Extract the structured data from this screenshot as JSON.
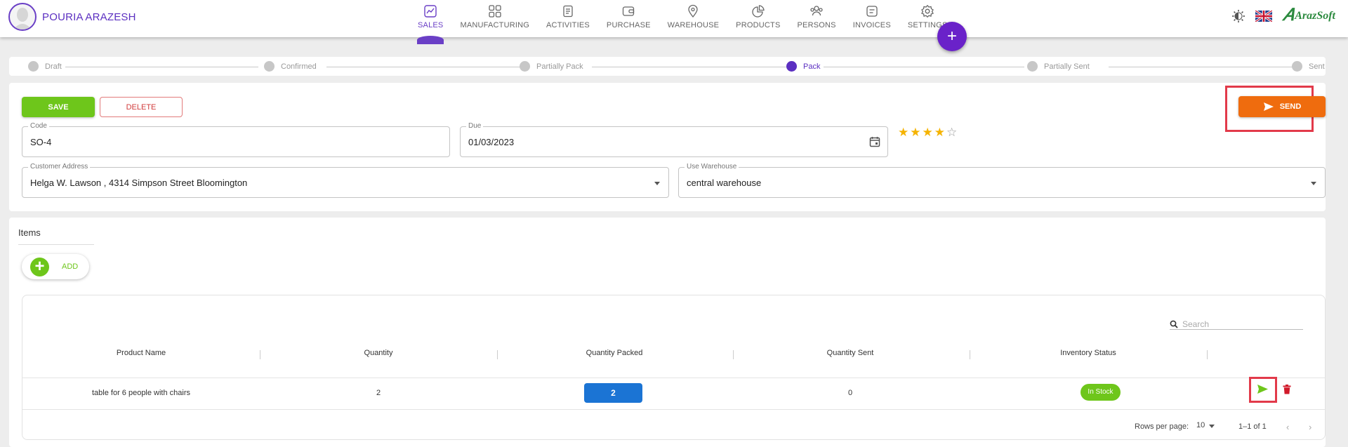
{
  "user": {
    "name": "POURIA ARAZESH"
  },
  "nav": [
    {
      "label": "SALES",
      "icon": "sales-icon",
      "active": true
    },
    {
      "label": "MANUFACTURING",
      "icon": "manufacturing-icon"
    },
    {
      "label": "ACTIVITIES",
      "icon": "activities-icon"
    },
    {
      "label": "PURCHASE",
      "icon": "purchase-icon"
    },
    {
      "label": "WAREHOUSE",
      "icon": "warehouse-icon"
    },
    {
      "label": "PRODUCTS",
      "icon": "products-icon"
    },
    {
      "label": "PERSONS",
      "icon": "persons-icon"
    },
    {
      "label": "INVOICES",
      "icon": "invoices-icon"
    },
    {
      "label": "SETTINGS",
      "icon": "settings-icon"
    }
  ],
  "fab": {
    "label": "+"
  },
  "brand": {
    "logo_text": "ArazSoft",
    "accent": "#6a3fc6"
  },
  "steps": [
    {
      "label": "Draft"
    },
    {
      "label": "Confirmed"
    },
    {
      "label": "Partially Pack"
    },
    {
      "label": "Pack",
      "active": true
    },
    {
      "label": "Partially Sent"
    },
    {
      "label": "Sent"
    }
  ],
  "form": {
    "save_label": "SAVE",
    "delete_label": "DELETE",
    "send_label": "SEND",
    "code": {
      "label": "Code",
      "value": "SO-4"
    },
    "due": {
      "label": "Due",
      "value": "01/03/2023"
    },
    "customer_address": {
      "label": "Customer Address",
      "value": "Helga W. Lawson , 4314 Simpson Street Bloomington"
    },
    "warehouse": {
      "label": "Use Warehouse",
      "value": "central warehouse"
    },
    "rating": {
      "value": 4,
      "max": 5
    }
  },
  "items": {
    "title": "Items",
    "add_label": "ADD",
    "search_placeholder": "Search",
    "columns": [
      "Product Name",
      "Quantity",
      "Quantity Packed",
      "Quantity Sent",
      "Inventory Status"
    ],
    "rows": [
      {
        "product": "table for 6 people with chairs",
        "quantity": "2",
        "packed": "2",
        "sent": "0",
        "status": "In Stock"
      }
    ],
    "pagination": {
      "rows_label": "Rows per page:",
      "rows_value": "10",
      "range": "1–1 of 1"
    }
  },
  "colors": {
    "save": "#6ec61b",
    "send": "#ef6c0e",
    "packed": "#1b74d4",
    "highlight": "#e23a4a"
  }
}
